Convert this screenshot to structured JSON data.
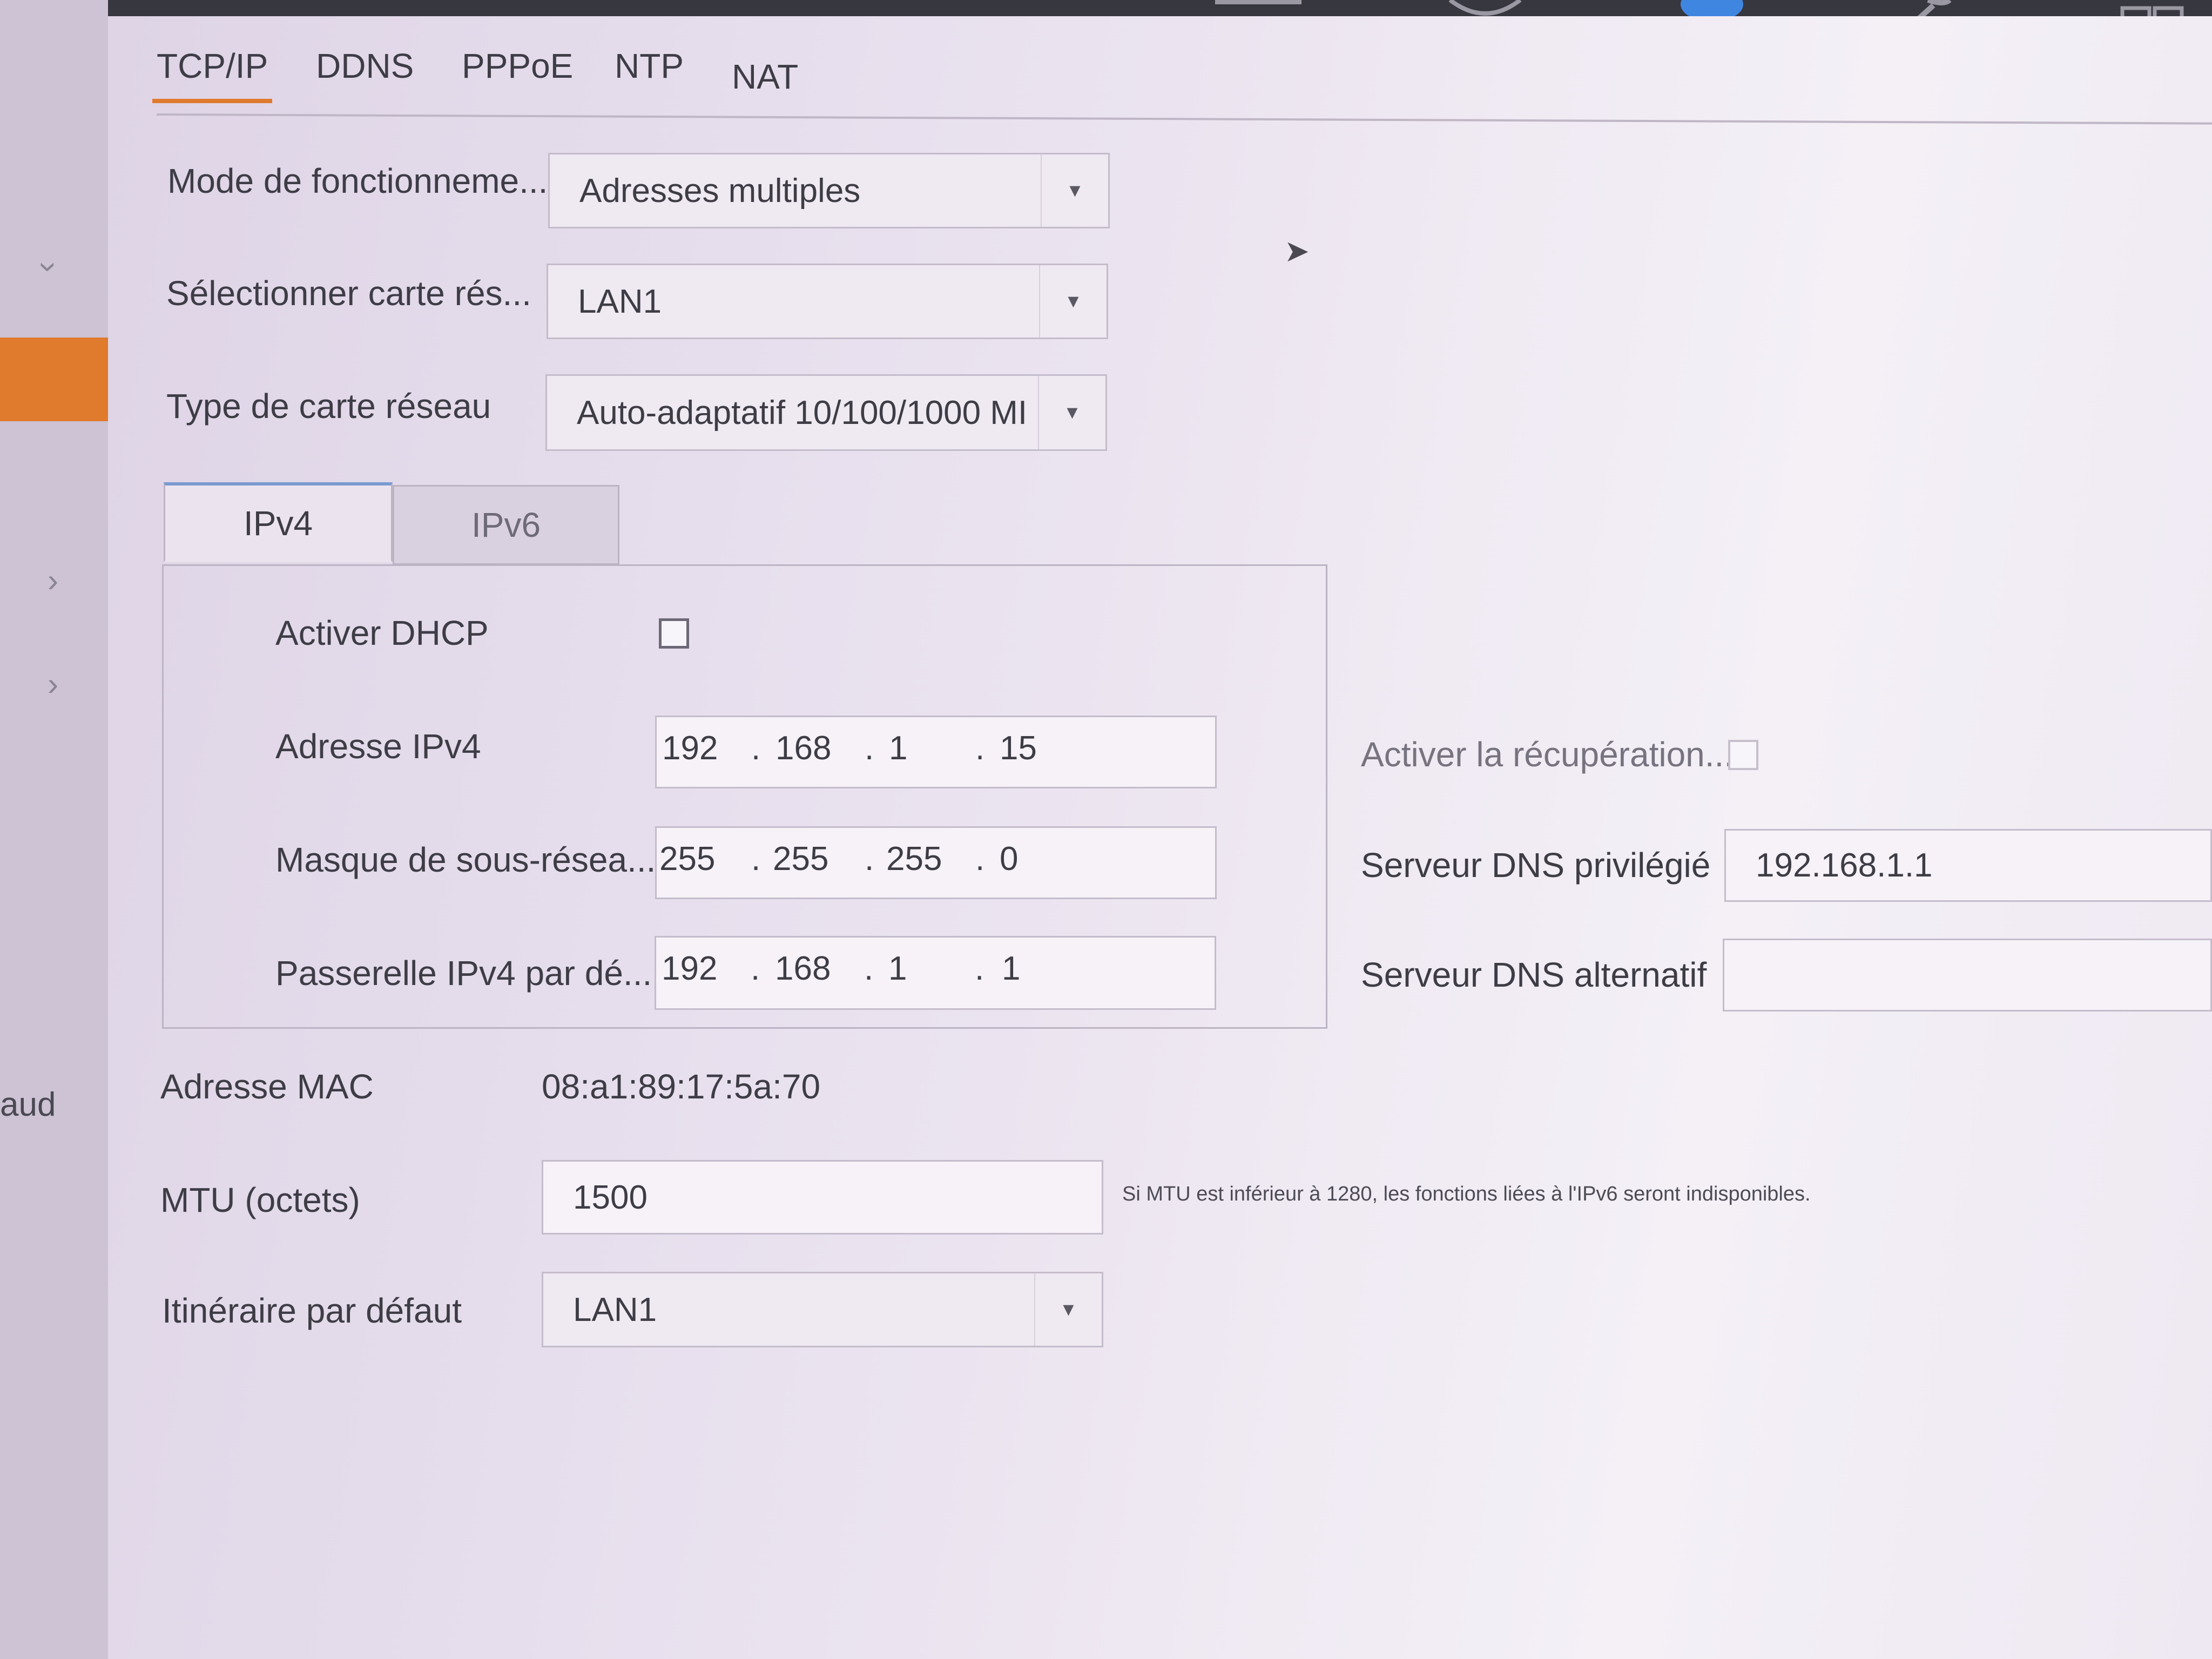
{
  "tabs": [
    "TCP/IP",
    "DDNS",
    "PPPoE",
    "NTP",
    "NAT"
  ],
  "sidebar": {
    "cut_label": "aud"
  },
  "form": {
    "work_mode": {
      "label": "Mode de fonctionneme...",
      "value": "Adresses multiples"
    },
    "select_nic": {
      "label": "Sélectionner carte rés...",
      "value": "LAN1"
    },
    "nic_type": {
      "label": "Type de carte réseau",
      "value": "Auto-adaptatif 10/100/1000 MI"
    }
  },
  "ip_tabs": [
    "IPv4",
    "IPv6"
  ],
  "ipv4": {
    "dhcp_label": "Activer DHCP",
    "address": {
      "label": "Adresse IPv4",
      "octets": [
        "192",
        "168",
        "1",
        "15"
      ]
    },
    "mask": {
      "label": "Masque de sous-résea...",
      "octets": [
        "255",
        "255",
        "255",
        "0"
      ]
    },
    "gateway": {
      "label": "Passerelle IPv4 par dé...",
      "octets": [
        "192",
        "168",
        "1",
        "1"
      ]
    }
  },
  "dns": {
    "recovery_label": "Activer la récupération...",
    "preferred": {
      "label": "Serveur DNS privilégié",
      "value": "192.168.1.1"
    },
    "alternate": {
      "label": "Serveur DNS alternatif",
      "value": ""
    }
  },
  "mac": {
    "label": "Adresse MAC",
    "value": "08:a1:89:17:5a:70"
  },
  "mtu": {
    "label": "MTU (octets)",
    "value": "1500",
    "note": "Si MTU est inférieur à 1280, les fonctions liées à l'IPv6 seront indisponibles."
  },
  "default_route": {
    "label": "Itinéraire par défaut",
    "value": "LAN1"
  },
  "colors": {
    "accent": "#e07a2c",
    "topbar": "#37373f"
  }
}
